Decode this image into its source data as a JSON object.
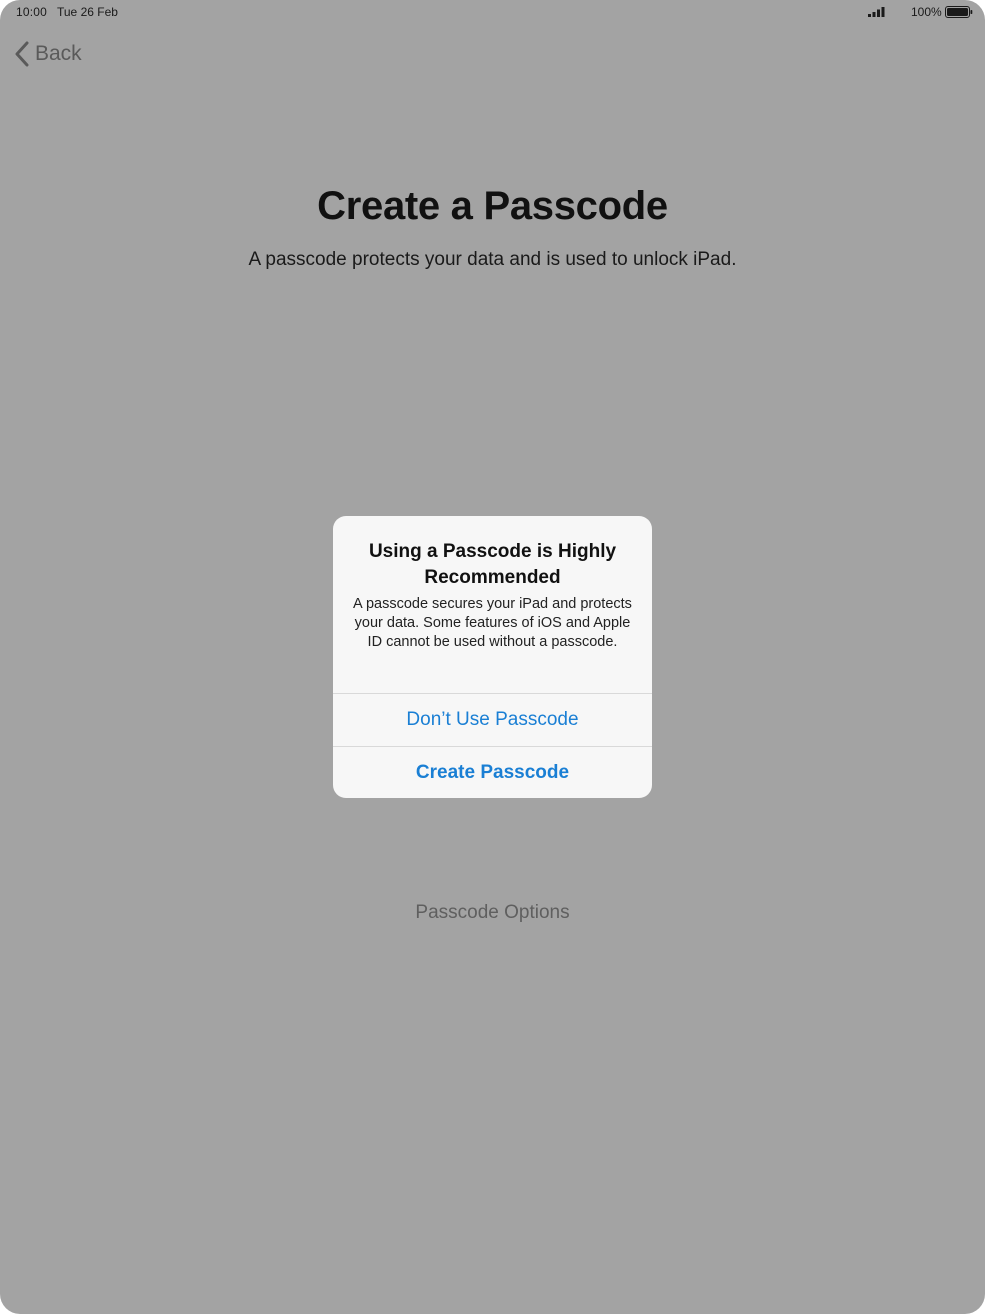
{
  "status_bar": {
    "time": "10:00",
    "date": "Tue 26 Feb",
    "battery_percent": "100%"
  },
  "nav": {
    "back_label": "Back"
  },
  "page": {
    "title": "Create a Passcode",
    "subtitle": "A passcode protects your data and is used to unlock iPad.",
    "options_label": "Passcode Options"
  },
  "alert": {
    "title": "Using a Passcode is Highly Recommended",
    "message": "A passcode secures your iPad and protects your data. Some features of iOS and Apple ID cannot be used without a passcode.",
    "dont_use_label": "Don’t Use Passcode",
    "create_label": "Create Passcode"
  },
  "colors": {
    "background": "#a3a3a3",
    "accent": "#1a7fd4",
    "alert_background": "#f7f7f7"
  }
}
